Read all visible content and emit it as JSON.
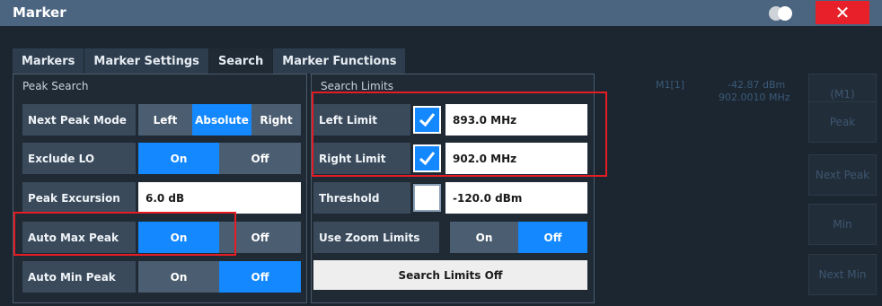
{
  "dialog": {
    "title": "Marker",
    "close_label": "✕",
    "tabs": [
      {
        "label": "Markers"
      },
      {
        "label": "Marker Settings"
      },
      {
        "label": "Search"
      },
      {
        "label": "Marker Functions"
      }
    ]
  },
  "background": {
    "marker_label": "M1[1]",
    "marker_value": "-42.87 dBm",
    "marker_freq": "902.0010 MHz",
    "softkeys": [
      "(M1)",
      "Peak",
      "Next Peak",
      "Min",
      "Next Min"
    ]
  },
  "peak_search": {
    "group_label": "Peak Search",
    "next_peak_mode": {
      "label": "Next Peak Mode",
      "options": [
        "Left",
        "Absolute",
        "Right"
      ],
      "selected": "Absolute"
    },
    "exclude_lo": {
      "label": "Exclude LO",
      "on": "On",
      "off": "Off",
      "selected": "On"
    },
    "peak_excursion": {
      "label": "Peak Excursion",
      "value": "6.0 dB"
    },
    "auto_max_peak": {
      "label": "Auto Max Peak",
      "on": "On",
      "off": "Off",
      "selected": "On"
    },
    "auto_min_peak": {
      "label": "Auto Min Peak",
      "on": "On",
      "off": "Off",
      "selected": "Off"
    }
  },
  "search_limits": {
    "group_label": "Search Limits",
    "left_limit": {
      "label": "Left Limit",
      "checked": true,
      "value": "893.0 MHz"
    },
    "right_limit": {
      "label": "Right Limit",
      "checked": true,
      "value": "902.0 MHz"
    },
    "threshold": {
      "label": "Threshold",
      "checked": false,
      "value": "-120.0 dBm"
    },
    "use_zoom_limits": {
      "label": "Use Zoom Limits",
      "on": "On",
      "off": "Off",
      "selected": "Off"
    },
    "search_limits_off_label": "Search Limits Off"
  },
  "colors": {
    "accent": "#1388ff",
    "highlight_box": "#e41d25",
    "titlebar": "#4b6580"
  }
}
